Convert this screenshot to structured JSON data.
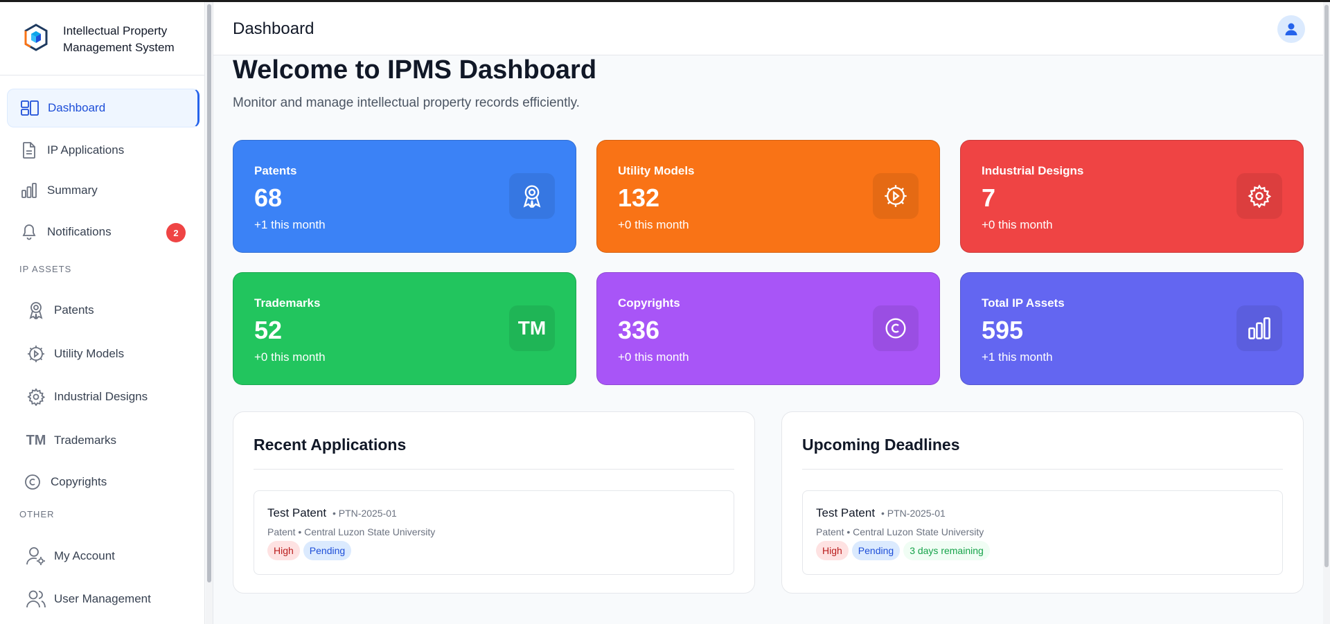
{
  "app": {
    "name": "Intellectual Property Management System"
  },
  "sidebar": {
    "main_items": [
      {
        "label": "Dashboard",
        "icon": "dashboard-icon",
        "active": true
      },
      {
        "label": "IP Applications",
        "icon": "document-icon"
      },
      {
        "label": "Summary",
        "icon": "bar-chart-icon"
      },
      {
        "label": "Notifications",
        "icon": "bell-icon",
        "badge": "2"
      }
    ],
    "section_ip_assets": "IP ASSETS",
    "ip_items": [
      {
        "label": "Patents",
        "icon": "award-icon"
      },
      {
        "label": "Utility Models",
        "icon": "cog-play-icon"
      },
      {
        "label": "Industrial Designs",
        "icon": "gear-icon"
      },
      {
        "label": "Trademarks",
        "icon": "trademark-icon"
      },
      {
        "label": "Copyrights",
        "icon": "copyright-icon"
      }
    ],
    "section_other": "OTHER",
    "other_items": [
      {
        "label": "My Account",
        "icon": "user-gear-icon"
      },
      {
        "label": "User Management",
        "icon": "users-icon"
      }
    ]
  },
  "header": {
    "title": "Dashboard"
  },
  "welcome": {
    "title": "Welcome to IPMS Dashboard",
    "subtitle": "Monitor and manage intellectual property records efficiently."
  },
  "stats": [
    {
      "label": "Patents",
      "value": "68",
      "delta": "+1 this month",
      "color": "#3b82f6",
      "icon": "award-icon"
    },
    {
      "label": "Utility Models",
      "value": "132",
      "delta": "+0 this month",
      "color": "#f97316",
      "icon": "cog-play-icon"
    },
    {
      "label": "Industrial Designs",
      "value": "7",
      "delta": "+0 this month",
      "color": "#ef4444",
      "icon": "gear-icon"
    },
    {
      "label": "Trademarks",
      "value": "52",
      "delta": "+0 this month",
      "color": "#22c55e",
      "icon": "trademark-icon"
    },
    {
      "label": "Copyrights",
      "value": "336",
      "delta": "+0 this month",
      "color": "#a855f7",
      "icon": "copyright-icon"
    },
    {
      "label": "Total IP Assets",
      "value": "595",
      "delta": "+1 this month",
      "color": "#6366f1",
      "icon": "bar-chart-icon"
    }
  ],
  "recent_applications": {
    "title": "Recent Applications",
    "items": [
      {
        "title": "Test Patent",
        "code": "• PTN-2025-01",
        "meta": "Patent • Central Luzon State University",
        "priority": "High",
        "status": "Pending"
      }
    ]
  },
  "upcoming_deadlines": {
    "title": "Upcoming Deadlines",
    "items": [
      {
        "title": "Test Patent",
        "code": "• PTN-2025-01",
        "meta": "Patent • Central Luzon State University",
        "priority": "High",
        "status": "Pending",
        "remaining": "3 days remaining"
      }
    ]
  }
}
